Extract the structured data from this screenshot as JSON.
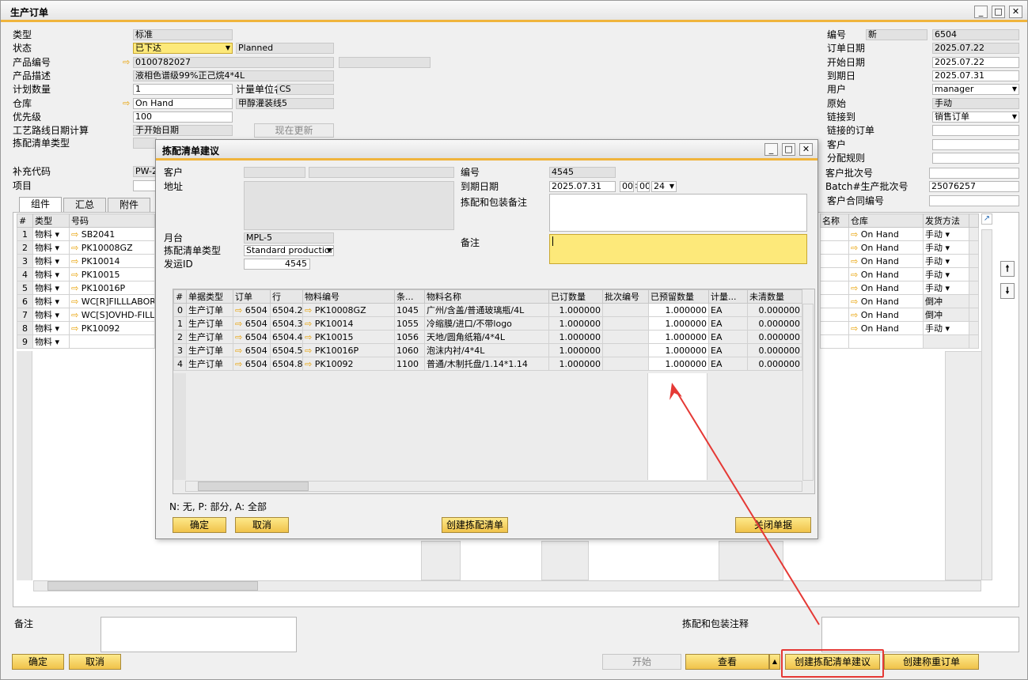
{
  "main": {
    "title": "生产订单",
    "left": [
      {
        "label": "类型",
        "value": "标准"
      },
      {
        "label": "状态",
        "value": "已下达",
        "value2": "Planned"
      },
      {
        "label": "产品编号",
        "value": "0100782027"
      },
      {
        "label": "产品描述",
        "value": "液相色谱级99%正己烷4*4L"
      },
      {
        "label": "计划数量",
        "value": "1",
        "label2": "计量单位名",
        "value2": "CS"
      },
      {
        "label": "仓库",
        "value": "On Hand",
        "value2": "甲醇灌装线5"
      },
      {
        "label": "优先级",
        "value": "100"
      },
      {
        "label": "工艺路线日期计算",
        "value": "于开始日期",
        "btn": "现在更新"
      },
      {
        "label": "拣配清单类型"
      },
      {
        "label": "补充代码",
        "value": "PW-2"
      },
      {
        "label": "项目"
      }
    ],
    "right": [
      {
        "label": "编号",
        "value": "新",
        "value2": "6504"
      },
      {
        "label": "订单日期",
        "value": "2025.07.22"
      },
      {
        "label": "开始日期",
        "value": "2025.07.22"
      },
      {
        "label": "到期日",
        "value": "2025.07.31"
      },
      {
        "label": "用户",
        "value": "manager"
      },
      {
        "label": "原始",
        "value": "手动"
      },
      {
        "label": "链接到",
        "value": "销售订单"
      },
      {
        "label": "链接的订单",
        "value": ""
      },
      {
        "label": "客户",
        "value": ""
      },
      {
        "label": "分配规则",
        "value": ""
      },
      {
        "label": "客户批次号",
        "value": ""
      },
      {
        "label": "Batch#生产批次号",
        "value": "25076257"
      },
      {
        "label": "客户合同编号",
        "value": ""
      }
    ],
    "tabs": [
      "组件",
      "汇总",
      "附件"
    ],
    "grid": {
      "headers": [
        "#",
        "类型",
        "号码"
      ],
      "rows": [
        [
          "1",
          "物料",
          "SB2041"
        ],
        [
          "2",
          "物料",
          "PK10008GZ"
        ],
        [
          "3",
          "物料",
          "PK10014"
        ],
        [
          "4",
          "物料",
          "PK10015"
        ],
        [
          "5",
          "物料",
          "PK10016P"
        ],
        [
          "6",
          "物料",
          "WC[R]FILLLABOR"
        ],
        [
          "7",
          "物料",
          "WC[S]OVHD-FILLIN"
        ],
        [
          "8",
          "物料",
          "PK10092"
        ],
        [
          "9",
          "物料",
          ""
        ]
      ],
      "right_headers": [
        "名称",
        "仓库",
        "发货方法"
      ],
      "right_rows": [
        [
          "On Hand",
          "手动"
        ],
        [
          "On Hand",
          "手动"
        ],
        [
          "On Hand",
          "手动"
        ],
        [
          "On Hand",
          "手动"
        ],
        [
          "On Hand",
          "手动"
        ],
        [
          "On Hand",
          "倒冲"
        ],
        [
          "On Hand",
          "倒冲"
        ],
        [
          "On Hand",
          "手动"
        ]
      ]
    },
    "remarks_label": "备注",
    "pick_notes_label": "拣配和包装注释",
    "buttons": {
      "ok": "确定",
      "cancel": "取消",
      "start": "开始",
      "view": "查看",
      "create_pick": "创建拣配清单建议",
      "create_weigh": "创建称重订单"
    }
  },
  "dialog": {
    "title": "拣配清单建议",
    "customer_label": "客户",
    "address_label": "地址",
    "platform_label": "月台",
    "platform_value": "MPL-5",
    "picktype_label": "拣配清单类型",
    "picktype_value": "Standard production",
    "shipid_label": "发运ID",
    "shipid_value": "4545",
    "no_label": "编号",
    "no_value": "4545",
    "due_label": "到期日期",
    "due_value": "2025.07.31",
    "time_h": "00",
    "time_m": "00",
    "time_24": "24",
    "pack_label": "拣配和包装备注",
    "remark_label": "备注",
    "headers": [
      "#",
      "单据类型",
      "订单",
      "行",
      "物料编号",
      "条...",
      "物料名称",
      "已订数量",
      "批次编号",
      "已预留数量",
      "计量...",
      "未清数量"
    ],
    "rows": [
      [
        "0",
        "生产订单",
        "6504",
        "6504.2",
        "PK10008GZ",
        "1045",
        "广州/含盖/普通玻璃瓶/4L",
        "1.000000",
        "",
        "1.000000",
        "EA",
        "0.000000"
      ],
      [
        "1",
        "生产订单",
        "6504",
        "6504.3",
        "PK10014",
        "1055",
        "冷缩膜/进口/不带logo",
        "1.000000",
        "",
        "1.000000",
        "EA",
        "0.000000"
      ],
      [
        "2",
        "生产订单",
        "6504",
        "6504.4",
        "PK10015",
        "1056",
        "天地/圆角纸箱/4*4L",
        "1.000000",
        "",
        "1.000000",
        "EA",
        "0.000000"
      ],
      [
        "3",
        "生产订单",
        "6504",
        "6504.5",
        "PK10016P",
        "1060",
        "泡沫内衬/4*4L",
        "1.000000",
        "",
        "1.000000",
        "EA",
        "0.000000"
      ],
      [
        "4",
        "生产订单",
        "6504",
        "6504.8",
        "PK10092",
        "1100",
        "普通/木制托盘/1.14*1.14",
        "1.000000",
        "",
        "1.000000",
        "EA",
        "0.000000"
      ]
    ],
    "legend": "N: 无, P: 部分, A: 全部",
    "buttons": {
      "ok": "确定",
      "cancel": "取消",
      "create": "创建拣配清单",
      "close": "关闭单据"
    }
  },
  "colors": {
    "accent": "#f0c24a",
    "highlight": "#e53935"
  }
}
